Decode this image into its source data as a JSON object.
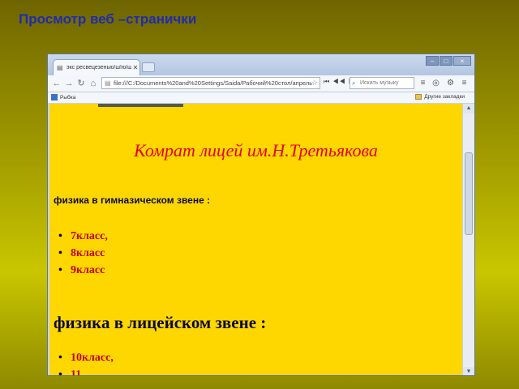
{
  "slide": {
    "title": "Просмотр веб –странички"
  },
  "browser": {
    "tab": {
      "label": "экс ресвецезенью/ш!ю/ш"
    },
    "window_controls": {
      "minimize": "–",
      "maximize": "□",
      "close": "×"
    },
    "address": "file:///C:/Documents%20and%20Settings/Saida/Рабочий%20стол/апрель",
    "search_placeholder": "Искать музыку",
    "media_controls": "⏮ ◀◀ ▶▶",
    "bookmarks": {
      "left": "Рыбка",
      "right": "Другие закладки"
    }
  },
  "page": {
    "site_title": "Комрат лицей им.Н.Третьякова",
    "section1_title": "физика в гимназическом звене :",
    "section1_items": [
      "7класс,",
      "8класс",
      "9класс"
    ],
    "section2_title": "физика в лицейском звене :",
    "section2_items": [
      "10класс,",
      "11..."
    ]
  },
  "colors": {
    "page_bg": "#ffd700",
    "site_title": "#e8000b",
    "list_items": "#c4000a",
    "headings": "#0a0a3c",
    "slide_title": "#1f2bb0"
  },
  "icons": [
    "page-icon",
    "close-icon",
    "back-icon",
    "forward-icon",
    "reload-icon",
    "home-icon",
    "star-icon",
    "search-icon",
    "menu-icon",
    "wrench-icon",
    "folder-icon"
  ]
}
